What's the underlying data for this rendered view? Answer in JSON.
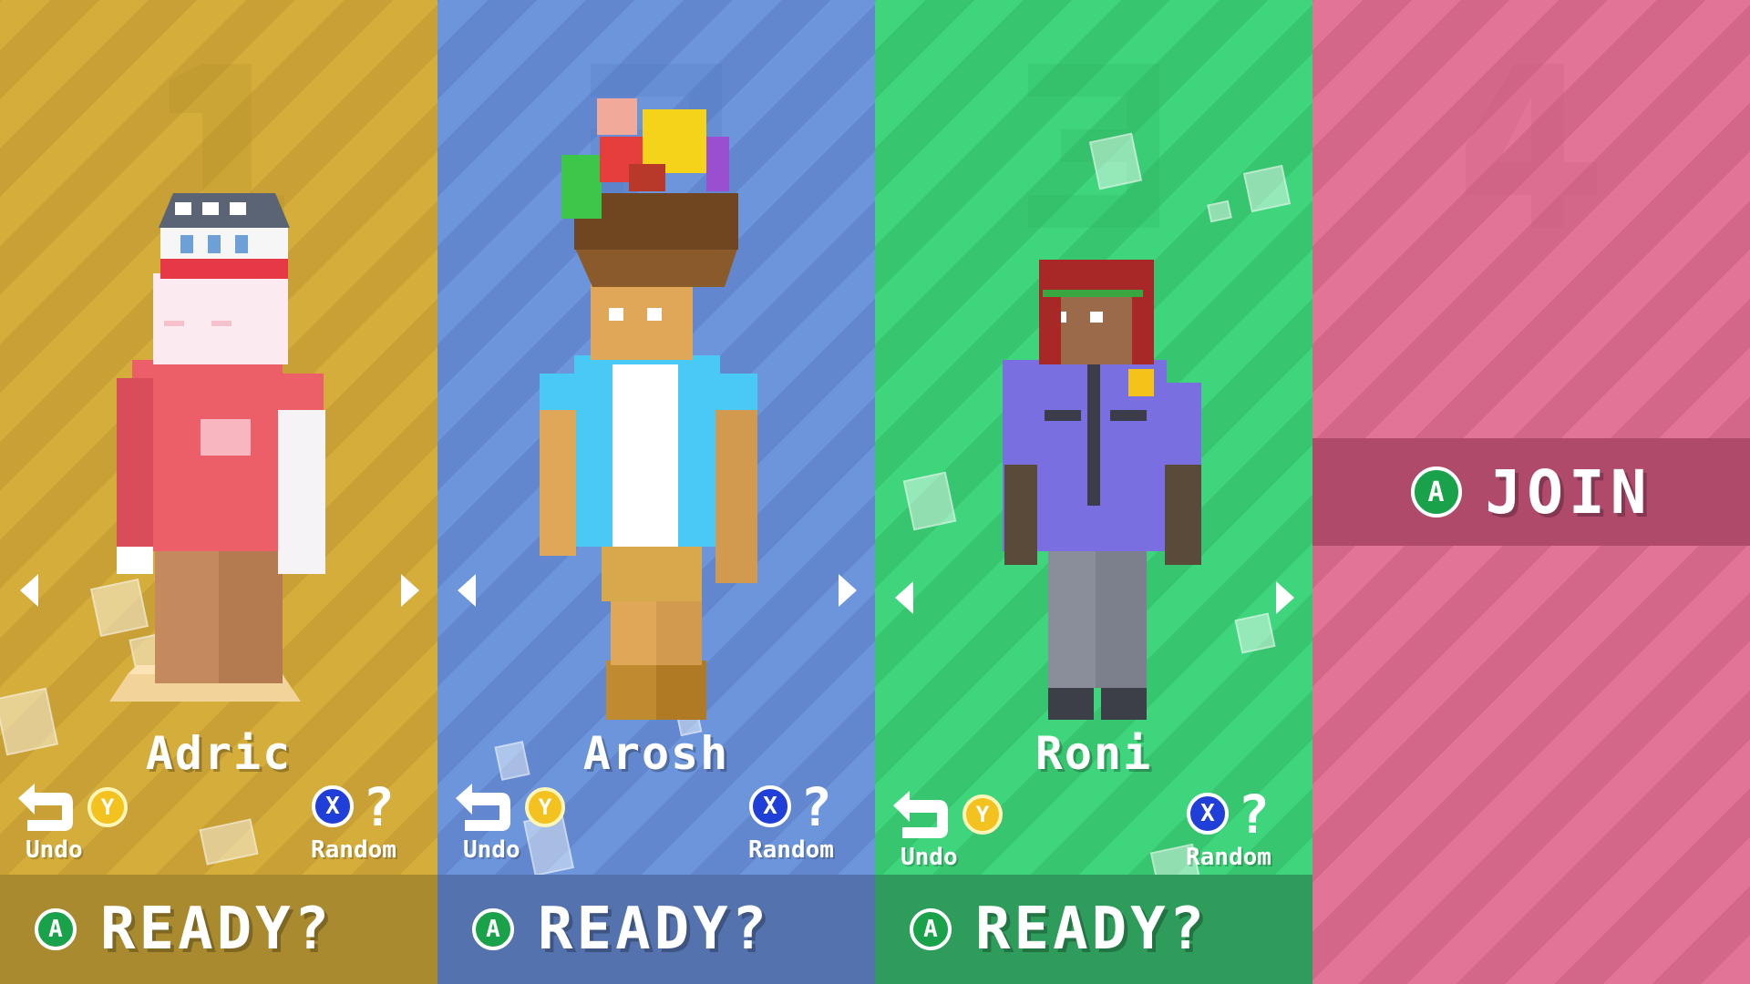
{
  "players": [
    {
      "character_name": "Adric",
      "undo_label": "Undo",
      "undo_button": "Y",
      "random_label": "Random",
      "random_button": "X",
      "random_glyph": "?",
      "ready_button": "A",
      "ready_label": "READY?",
      "panel_color": "#d4ad3b"
    },
    {
      "character_name": "Arosh",
      "undo_label": "Undo",
      "undo_button": "Y",
      "random_label": "Random",
      "random_button": "X",
      "random_glyph": "?",
      "ready_button": "A",
      "ready_label": "READY?",
      "panel_color": "#6c95dc"
    },
    {
      "character_name": "Roni",
      "undo_label": "Undo",
      "undo_button": "Y",
      "random_label": "Random",
      "random_button": "X",
      "random_glyph": "?",
      "ready_button": "A",
      "ready_label": "READY?",
      "panel_color": "#3fd57c"
    }
  ],
  "join_slot": {
    "join_button": "A",
    "join_label": "JOIN",
    "panel_color": "#e27597"
  },
  "icons": {
    "prev": "chevron-left-icon",
    "next": "chevron-right-icon",
    "undo": "undo-arrow-icon"
  }
}
